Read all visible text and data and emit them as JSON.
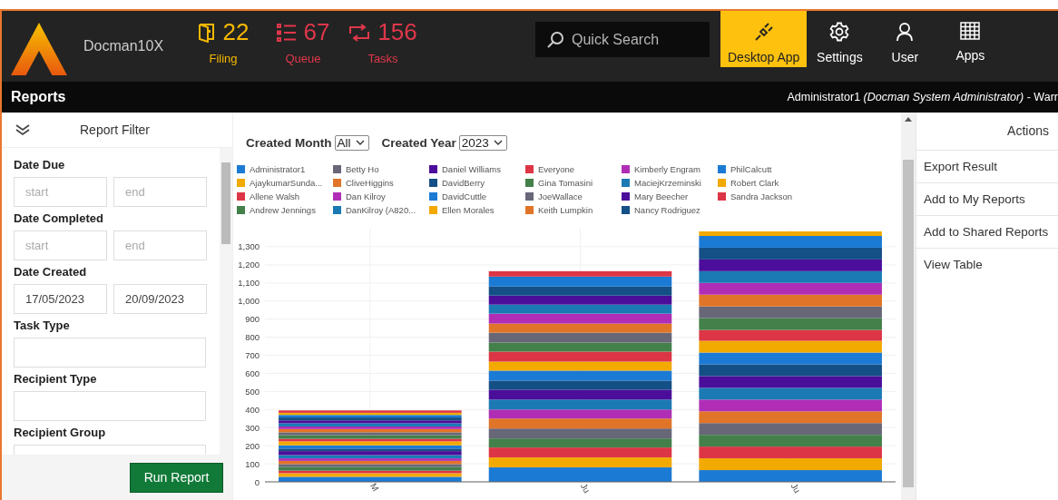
{
  "app": {
    "name": "Docman10X"
  },
  "counters": [
    {
      "kind": "filing",
      "count": "22",
      "label": "Filing",
      "color": "#f5b800"
    },
    {
      "kind": "queue",
      "count": "67",
      "label": "Queue",
      "color": "#e0374a"
    },
    {
      "kind": "tasks",
      "count": "156",
      "label": "Tasks",
      "color": "#e0374a"
    }
  ],
  "search": {
    "placeholder": "Quick Search"
  },
  "nav": [
    {
      "kind": "plug",
      "label": "Desktop App",
      "selected": true
    },
    {
      "kind": "gear",
      "label": "Settings",
      "selected": false
    },
    {
      "kind": "user",
      "label": "User",
      "selected": false
    },
    {
      "kind": "grid",
      "label": "Apps",
      "selected": false
    }
  ],
  "page_title": "Reports",
  "user_line": "Administrator1 *(Docman System Administrator)* - Warr",
  "filter": {
    "title": "Report Filter",
    "fields": [
      {
        "kind": "range",
        "label": "Date Due",
        "start": {
          "placeholder": "start"
        },
        "end": {
          "placeholder": "end"
        }
      },
      {
        "kind": "range",
        "label": "Date Completed",
        "start": {
          "placeholder": "start"
        },
        "end": {
          "placeholder": "end"
        }
      },
      {
        "kind": "range",
        "label": "Date Created",
        "start": {
          "value": "17/05/2023"
        },
        "end": {
          "value": "20/09/2023"
        }
      },
      {
        "kind": "text",
        "label": "Task Type"
      },
      {
        "kind": "text",
        "label": "Recipient Type"
      },
      {
        "kind": "text",
        "label": "Recipient Group"
      }
    ],
    "button": "Run Report"
  },
  "report": {
    "controls": [
      {
        "label": "Created Month",
        "value": "All"
      },
      {
        "label": "Created Year",
        "value": "2023"
      }
    ],
    "chart_data": {
      "type": "bar",
      "stacked": true,
      "categories": [
        "M",
        "Ju",
        "Ju"
      ],
      "ylim": [
        0,
        1400
      ],
      "grid": true,
      "legend": true,
      "yticks": [
        0,
        100,
        200,
        300,
        400,
        500,
        600,
        700,
        800,
        900,
        {
          "value": 1000,
          "label": "1,000"
        },
        {
          "value": 1100,
          "label": "1,100"
        },
        {
          "value": 1200,
          "label": "1,200"
        },
        {
          "value": 1300,
          "label": "1,300"
        }
      ],
      "series": [
        {
          "name": "Administrator1",
          "color": "#1b7ad4",
          "values": [
            28,
            80,
            65
          ]
        },
        {
          "name": "AjaykumarSunda...",
          "color": "#f2a900",
          "values": [
            20,
            55,
            65
          ]
        },
        {
          "name": "Allene Walsh",
          "color": "#dc3545",
          "values": [
            14,
            55,
            65
          ]
        },
        {
          "name": "Andrew Jennings",
          "color": "#43804a",
          "values": [
            20,
            50,
            65
          ]
        },
        {
          "name": "Betty Ho",
          "color": "#676778",
          "values": [
            16,
            55,
            65
          ]
        },
        {
          "name": "CliveHiggins",
          "color": "#e07428",
          "values": [
            18,
            55,
            65
          ]
        },
        {
          "name": "Dan Kilroy",
          "color": "#b02eb5",
          "values": [
            14,
            50,
            65
          ]
        },
        {
          "name": "DanKilroy (A820...",
          "color": "#1b7ab3",
          "values": [
            18,
            55,
            65
          ]
        },
        {
          "name": "Daniel Williams",
          "color": "#4b0e9a",
          "values": [
            22,
            55,
            65
          ]
        },
        {
          "name": "DavidBerry",
          "color": "#144f85",
          "values": [
            14,
            50,
            65
          ]
        },
        {
          "name": "DavidCuttle",
          "color": "#1b7ad4",
          "values": [
            18,
            55,
            65
          ]
        },
        {
          "name": "Ellen Morales",
          "color": "#f2a900",
          "values": [
            22,
            50,
            65
          ]
        },
        {
          "name": "Everyone",
          "color": "#dc3545",
          "values": [
            14,
            55,
            60
          ]
        },
        {
          "name": "Gina Tomasini",
          "color": "#43804a",
          "values": [
            20,
            50,
            65
          ]
        },
        {
          "name": "JoeWallace",
          "color": "#676778",
          "values": [
            16,
            55,
            65
          ]
        },
        {
          "name": "Keith Lumpkin",
          "color": "#e07428",
          "values": [
            18,
            50,
            65
          ]
        },
        {
          "name": "Kimberly Engram",
          "color": "#b02eb5",
          "values": [
            14,
            55,
            65
          ]
        },
        {
          "name": "MaciejKrzeminski",
          "color": "#1b7ab3",
          "values": [
            18,
            50,
            65
          ]
        },
        {
          "name": "Mary Beecher",
          "color": "#4b0e9a",
          "values": [
            16,
            50,
            65
          ]
        },
        {
          "name": "Nancy Rodriguez",
          "color": "#144f85",
          "values": [
            16,
            50,
            65
          ]
        },
        {
          "name": "PhilCalcutt",
          "color": "#1b7ad4",
          "values": [
            14,
            55,
            65
          ]
        },
        {
          "name": "Robert Clark",
          "color": "#f2a900",
          "values": [
            12,
            0,
            25
          ]
        },
        {
          "name": "Sandra Jackson",
          "color": "#dc3545",
          "values": [
            13,
            30,
            0
          ]
        }
      ]
    }
  },
  "actions": {
    "title": "Actions",
    "items": [
      "Export Result",
      "Add to My Reports",
      "Add to Shared Reports",
      "View Table"
    ]
  }
}
